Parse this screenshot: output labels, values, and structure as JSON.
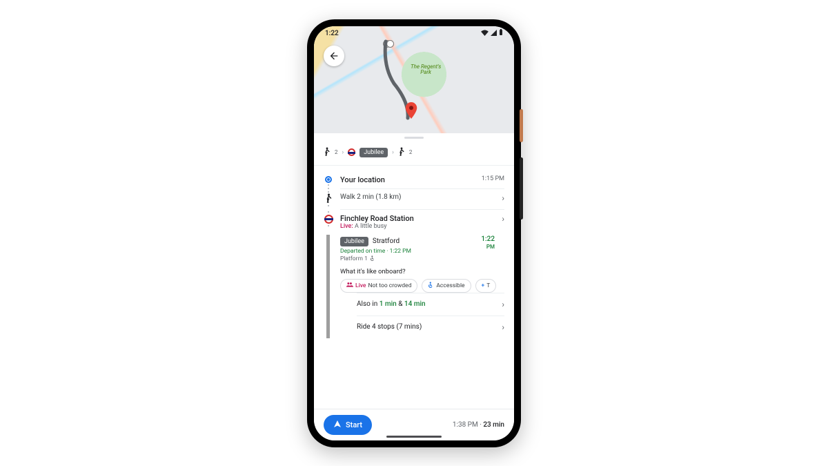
{
  "status": {
    "time": "1:22"
  },
  "map": {
    "park_label": "The Regent's\nPark"
  },
  "summary": {
    "walk1_min": "2",
    "line_name": "Jubilee",
    "walk2_min": "2"
  },
  "steps": {
    "your_location": {
      "label": "Your location",
      "time": "1:15 PM"
    },
    "walk": {
      "label": "Walk 2 min (1.8 km)"
    },
    "station": {
      "name": "Finchley Road Station",
      "live_label": "Live:",
      "live_text": "A little busy"
    },
    "train": {
      "line_chip": "Jubilee",
      "destination": "Stratford",
      "depart_text": "Departed on time · 1:22 PM",
      "platform_text": "Platform 1",
      "depart_time": "1:22",
      "depart_period": "PM",
      "onboard_question": "What it's like onboard?",
      "pills": {
        "crowd_live": "Live",
        "crowd_text": "Not too crowded",
        "accessible": "Accessible",
        "more_prefix": "T"
      },
      "also_prefix": "Also in ",
      "also_t1": "1 min",
      "also_amp": " & ",
      "also_t2": "14 min",
      "ride_text": "Ride 4 stops (7 mins)"
    }
  },
  "bottom": {
    "start_label": "Start",
    "arrive_time": "1:38 PM",
    "duration": "23 min"
  }
}
